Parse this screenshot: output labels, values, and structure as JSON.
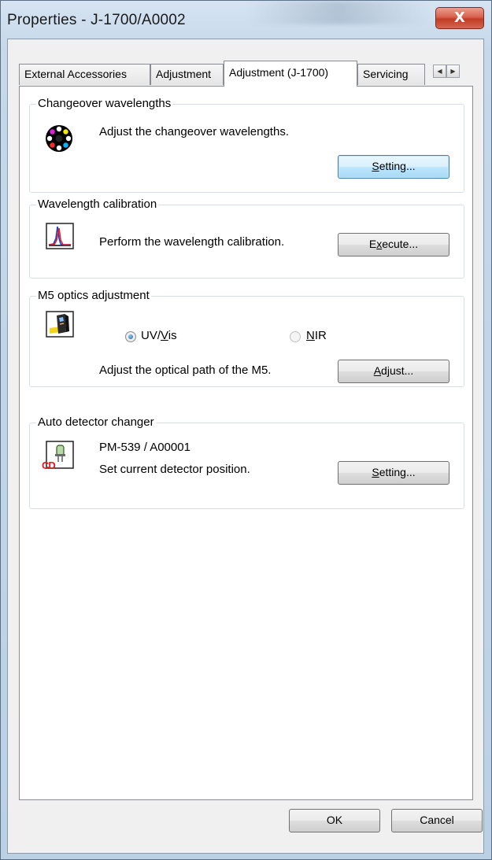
{
  "window": {
    "title": "Properties - J-1700/A0002",
    "close_glyph": "X"
  },
  "tabs": [
    {
      "label": "External Accessories",
      "active": false
    },
    {
      "label": "Adjustment",
      "active": false
    },
    {
      "label": "Adjustment (J-1700)",
      "active": true
    },
    {
      "label": "Servicing",
      "active": false
    }
  ],
  "tab_scroll": {
    "left_glyph": "◀",
    "right_glyph": "▶"
  },
  "groups": {
    "changeover": {
      "title": "Changeover wavelengths",
      "description": "Adjust the changeover wavelengths.",
      "button": {
        "pre": "",
        "accel": "S",
        "post": "etting..."
      },
      "icon": "color-wheel-icon"
    },
    "calibration": {
      "title": "Wavelength calibration",
      "description": "Perform the wavelength calibration.",
      "button": {
        "pre": "E",
        "accel": "x",
        "post": "ecute..."
      },
      "icon": "spectrum-peaks-icon"
    },
    "m5": {
      "title": "M5 optics adjustment",
      "radio_uvvis": {
        "pre": "UV/",
        "accel": "V",
        "post": "is",
        "checked": true
      },
      "radio_nir": {
        "pre": "",
        "accel": "N",
        "post": "IR",
        "checked": false
      },
      "description": "Adjust the optical path of the M5.",
      "button": {
        "pre": "",
        "accel": "A",
        "post": "djust..."
      },
      "icon": "optics-module-icon"
    },
    "detector": {
      "title": "Auto detector changer",
      "model": "PM-539 / A00001",
      "description": "Set current detector position.",
      "button": {
        "pre": "",
        "accel": "S",
        "post": "etting..."
      },
      "icon": "detector-cd-icon",
      "icon_text": "CD"
    }
  },
  "footer": {
    "ok_label": "OK",
    "cancel_label": "Cancel"
  },
  "colors": {
    "titlebar": "#c6d8ea",
    "close_button": "#c13c25",
    "focused_button": "#3c7fb1"
  }
}
